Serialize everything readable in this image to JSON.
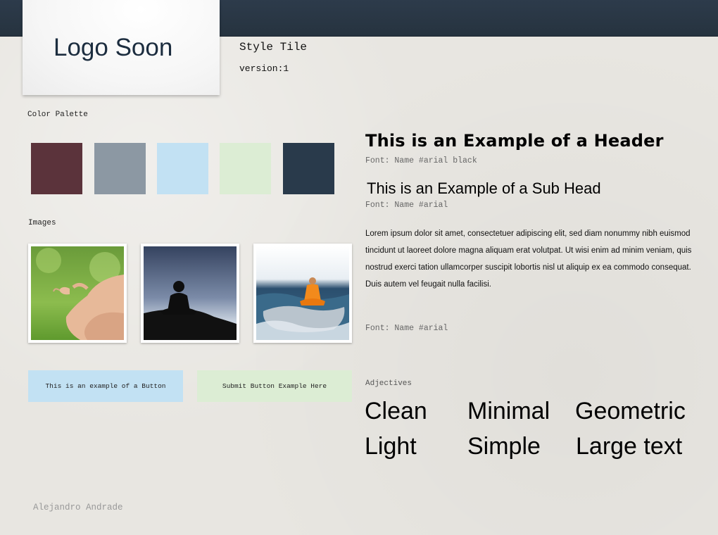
{
  "header": {
    "logo_text": "Logo Soon",
    "title": "Style Tile",
    "version": "version:1"
  },
  "palette": {
    "label": "Color Palette",
    "colors": [
      "#5b333b",
      "#8c98a3",
      "#c2e1f3",
      "#dcedd4",
      "#293a4b"
    ]
  },
  "images": {
    "label": "Images",
    "items": [
      "yoga-hands-photo",
      "meditation-silhouette-photo",
      "monk-on-ocean-rock-photo"
    ]
  },
  "buttons": {
    "primary_label": "This is an example of a Button",
    "primary_color": "#c2e1f3",
    "submit_label": "Submit Button Example Here",
    "submit_color": "#dcedd4"
  },
  "typography": {
    "header": "This is an Example of a Header",
    "header_font": "Font: Name #arial black",
    "subhead": "This is an Example of a Sub Head",
    "subhead_font": "Font: Name #arial",
    "body": "Lorem ipsum dolor sit amet, consectetuer adipiscing elit, sed diam nonummy nibh euismod tincidunt ut laoreet dolore magna aliquam erat volutpat. Ut wisi enim ad minim veniam, quis nostrud exerci tation ullamcorper suscipit lobortis nisl ut aliquip ex ea commodo consequat. Duis autem vel feugait nulla facilisi.",
    "body_font": "Font: Name #arial"
  },
  "adjectives": {
    "label": "Adjectives",
    "words": [
      "Clean",
      "Minimal",
      "Geometric",
      "Light",
      "Simple",
      "Large text"
    ]
  },
  "footer": {
    "author": "Alejandro Andrade"
  }
}
